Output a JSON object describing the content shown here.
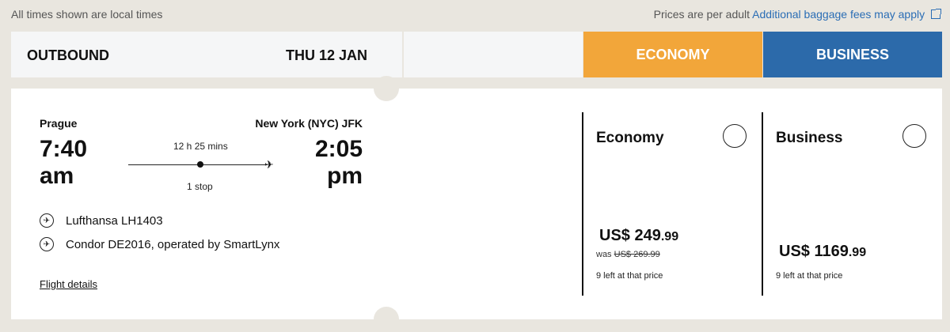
{
  "notes": {
    "local_times": "All times shown are local times",
    "price_note": "Prices are per adult",
    "baggage_link": "Additional baggage fees may apply"
  },
  "header": {
    "direction": "OUTBOUND",
    "date": "THU 12 JAN",
    "economy_tab": "ECONOMY",
    "business_tab": "BUSINESS"
  },
  "flight": {
    "origin": "Prague",
    "destination": "New York (NYC) JFK",
    "departure_time": "7:40 am",
    "arrival_time": "2:05 pm",
    "duration": "12 h 25 mins",
    "stops": "1 stop",
    "segments": [
      {
        "logo": "lufthansa-logo-icon",
        "text": "Lufthansa LH1403"
      },
      {
        "logo": "condor-logo-icon",
        "text": "Condor DE2016, operated by SmartLynx"
      }
    ],
    "details_link": "Flight details"
  },
  "fares": {
    "economy": {
      "name": "Economy",
      "price_main": "US$ 249",
      "price_cents": ".99",
      "was_label": "was",
      "was_price": "US$ 269.99",
      "availability": "9 left at that price"
    },
    "business": {
      "name": "Business",
      "price_main": "US$ 1169",
      "price_cents": ".99",
      "availability": "9 left at that price"
    }
  },
  "colors": {
    "economy": "#f2a63a",
    "business": "#2c6aaa",
    "background": "#e9e6df",
    "link": "#2a6db5"
  }
}
